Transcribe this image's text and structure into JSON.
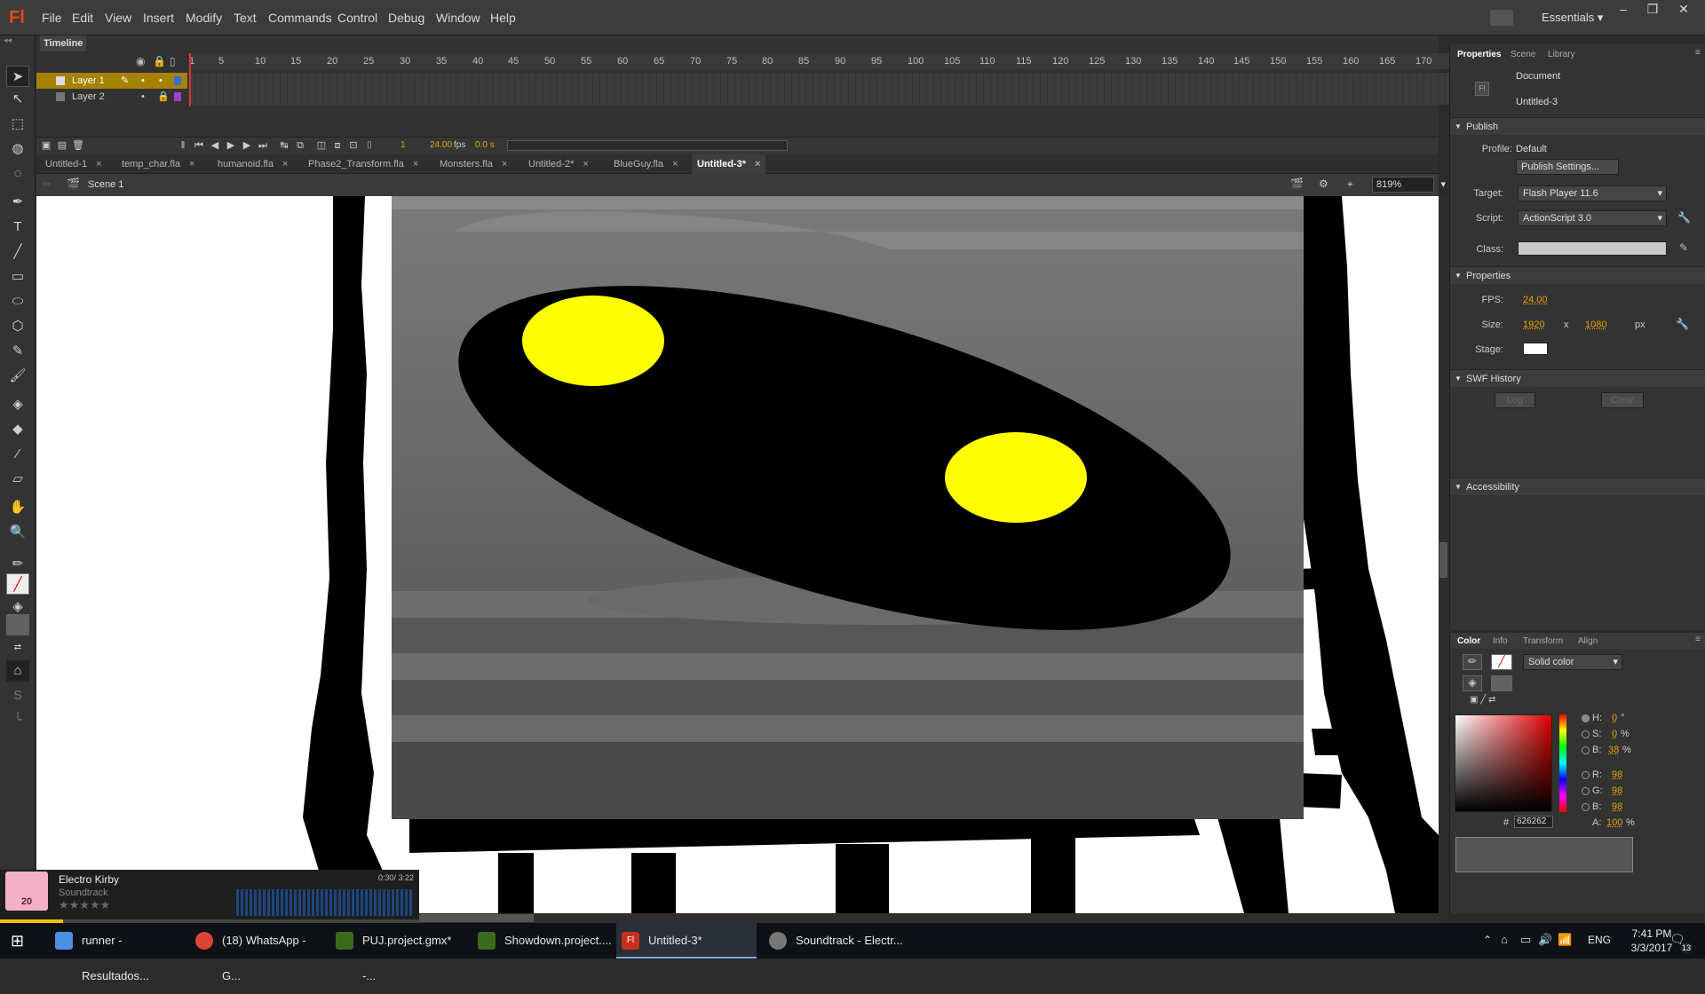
{
  "app": {
    "logo": "Fl",
    "workspace": "Essentials"
  },
  "menu": [
    "File",
    "Edit",
    "View",
    "Insert",
    "Modify",
    "Text",
    "Commands",
    "Control",
    "Debug",
    "Window",
    "Help"
  ],
  "timeline": {
    "tab": "Timeline",
    "layers": [
      "Layer 1",
      "Layer 2"
    ],
    "frame_numbers": [
      "1",
      "5",
      "10",
      "15",
      "20",
      "25",
      "30",
      "35",
      "40",
      "45",
      "50",
      "55",
      "60",
      "65",
      "70",
      "75",
      "80",
      "85",
      "90",
      "95",
      "100",
      "105",
      "110",
      "115",
      "120",
      "125",
      "130",
      "135",
      "140",
      "145",
      "150",
      "155",
      "160",
      "165",
      "170",
      "17"
    ],
    "current_frame": "1",
    "fps": "24.00",
    "fps_unit": "fps",
    "time": "0.0 s"
  },
  "doc_tabs": [
    "Untitled-1",
    "temp_char.fla",
    "humanoid.fla",
    "Phase2_Transform.fla",
    "Monsters.fla",
    "Untitled-2*",
    "BlueGuy.fla",
    "Untitled-3*"
  ],
  "tab_close": "×",
  "editbar": {
    "scene": "Scene 1",
    "zoom": "819%"
  },
  "properties": {
    "tabs": [
      "Properties",
      "Scene",
      "Library"
    ],
    "doc_type": "Document",
    "doc_name": "Untitled-3",
    "publish_title": "Publish",
    "profile_label": "Profile:",
    "profile_value": "Default",
    "publish_settings": "Publish Settings...",
    "target_label": "Target:",
    "target_value": "Flash Player 11.6",
    "script_label": "Script:",
    "script_value": "ActionScript 3.0",
    "class_label": "Class:",
    "props_title": "Properties",
    "fps_label": "FPS:",
    "fps_value": "24.00",
    "size_label": "Size:",
    "width": "1920",
    "size_x": "x",
    "height": "1080",
    "size_unit": "px",
    "stage_label": "Stage:",
    "swf_title": "SWF History",
    "log": "Log",
    "clear": "Clear",
    "accessibility": "Accessibility"
  },
  "color_panel": {
    "tabs": [
      "Color",
      "Info",
      "Transform",
      "Align"
    ],
    "fill_type": "Solid color",
    "h_label": "H:",
    "h": "0",
    "h_unit": "°",
    "s_label": "S:",
    "s": "0",
    "s_unit": "%",
    "b_label": "B:",
    "b": "38",
    "b_unit": "%",
    "r_label": "R:",
    "r": "98",
    "g_label": "G:",
    "g": "98",
    "b2_label": "B:",
    "b2": "98",
    "hex_label": "#",
    "hex": "626262",
    "a_label": "A:",
    "a": "100",
    "a_unit": "%"
  },
  "music": {
    "title": "Electro Kirby",
    "subtitle": "Soundtrack",
    "time": "0:30/ 3:22",
    "art_text": "20",
    "rating_stars": "★★★★★",
    "progress": 0.15
  },
  "taskbar": {
    "items": [
      "runner - Resultados...",
      "(18) WhatsApp - G...",
      "PUJ.project.gmx* -...",
      "Showdown.project....",
      "Untitled-3*",
      "Soundtrack - Electr..."
    ],
    "lang": "ENG",
    "time": "7:41 PM",
    "date": "3/3/2017",
    "notif": "13"
  },
  "colors": {
    "eye_yellow": "#ffff00",
    "body_black": "#000000",
    "stage_gray": "#626262",
    "accent_orange": "#e8a200",
    "layer_highlight": "#a58200"
  }
}
